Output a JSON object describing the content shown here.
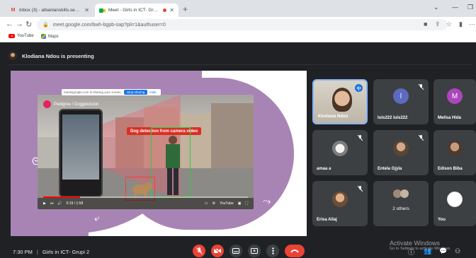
{
  "browser": {
    "tabs": [
      {
        "title": "Inbox (3) - albanianskills.secreta...",
        "favicon": "gmail-icon",
        "active": false
      },
      {
        "title": "Meet - Girls in ICT- Grupi 2",
        "favicon": "meet-icon",
        "active": true
      }
    ],
    "url": "meet.google.com/bwh-bgpb-oap?pli=1&authuser=0",
    "bookmarks": [
      "YouTube",
      "Maps"
    ]
  },
  "meet": {
    "presenting_text": "Klodiana Ndou is presenting",
    "shared_screen": {
      "channel_name": "Pedigree / Doggievision",
      "sharing_text": "meetsgoogle.com is sharing your screen.",
      "stop_sharing_label": "Stop sharing",
      "hide_label": "Hide",
      "detection_label": "Dog detection from camera video",
      "video_time": "0:19 / 1:58",
      "video_progress": 0.18,
      "youtube_label": "YouTube"
    },
    "participants": [
      {
        "name": "Klodiana Ndou",
        "type": "video",
        "speaking": true,
        "muted": false
      },
      {
        "name": "luis222 luis222",
        "type": "letter",
        "letter": "l",
        "avatar_color": "#5c6bc0",
        "muted": true
      },
      {
        "name": "Melisa Hida",
        "type": "letter",
        "letter": "M",
        "avatar_color": "#ab47bc",
        "muted": true
      },
      {
        "name": "amaa a",
        "type": "photo",
        "muted": true
      },
      {
        "name": "Entela Gjyla",
        "type": "photo",
        "muted": true
      },
      {
        "name": "Edison Biba",
        "type": "photo",
        "muted": true
      },
      {
        "name": "Erisa Aliaj",
        "type": "photo",
        "muted": true
      },
      {
        "name": "2 others",
        "type": "others",
        "muted": false
      },
      {
        "name": "You",
        "type": "photo",
        "muted": false
      }
    ],
    "time": "7:30 PM",
    "meeting_name": "Girls in ICT- Grupi 2",
    "separator": "|"
  },
  "watermark": {
    "line1": "Activate Windows",
    "line2": "Go to Settings to activate Windows."
  },
  "colors": {
    "meet_bg": "#202124",
    "tile_bg": "#3c4043",
    "danger": "#ea4335",
    "accent_purple": "#a884b4"
  }
}
